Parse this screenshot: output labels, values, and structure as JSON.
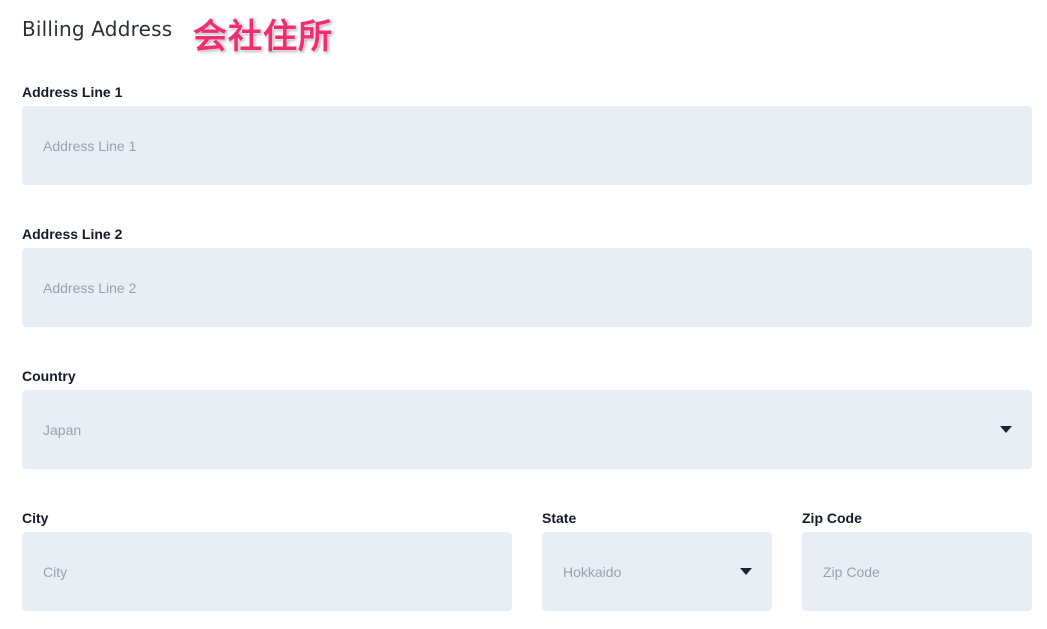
{
  "billing": {
    "title": "Billing Address",
    "annotation": "会社住所"
  },
  "fields": {
    "address1": {
      "label": "Address Line 1",
      "value": "",
      "placeholder": "Address Line 1"
    },
    "address2": {
      "label": "Address Line 2",
      "value": "",
      "placeholder": "Address Line 2"
    },
    "country": {
      "label": "Country",
      "selected": "Japan"
    },
    "city": {
      "label": "City",
      "value": "",
      "placeholder": "City"
    },
    "state": {
      "label": "State",
      "selected": "Hokkaido"
    },
    "zip": {
      "label": "Zip Code",
      "value": "",
      "placeholder": "Zip Code"
    }
  },
  "icons": {
    "select_caret": "caret-down-icon"
  },
  "colors": {
    "field_background": "#e9eef5",
    "annotation": "#ee2d72",
    "placeholder": "#9aa1ad"
  }
}
